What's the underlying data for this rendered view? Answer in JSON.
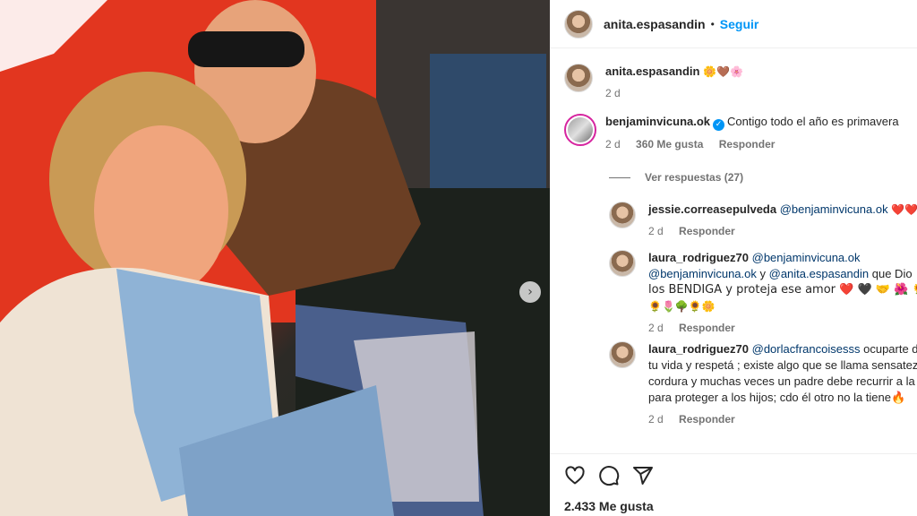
{
  "post": {
    "author": "anita.espasandin",
    "separator": "•",
    "follow_label": "Seguir",
    "likes_total": "2.433 Me gusta"
  },
  "comments": [
    {
      "user": "anita.espasandin",
      "text": "🌼🤎🌸",
      "time": "2 d"
    },
    {
      "user": "benjaminvicuna.ok",
      "text": "Contigo todo el año es primavera",
      "time": "2 d",
      "likes": "360 Me gusta",
      "reply": "Responder",
      "view_replies": "Ver respuestas (27)"
    }
  ],
  "replies": [
    {
      "user": "jessie.correasepulveda",
      "mention": "@benjaminvicuna.ok",
      "text": "❤️❤️",
      "time": "2 d",
      "reply": "Responder"
    },
    {
      "user": "laura_rodriguez70",
      "mention": "@benjaminvicuna.ok",
      "line2_mention1": "@benjaminvicuna.ok",
      "line2_y": "y",
      "line2_mention2": "@anita.espasandin",
      "line2_text": "que Dio",
      "line3": "los BENDIGA y proteja ese amor ❤️ 🖤 🤝 🌺 🌻 🌼",
      "line4": "🌻🌷🌳🌻🌼",
      "time": "2 d",
      "reply": "Responder"
    },
    {
      "user": "laura_rodriguez70",
      "mention": "@dorlacfrancoisesss",
      "text": "ocuparte d",
      "line2": "tu vida y respetá ; existe algo que se llama sensatez",
      "line3": "cordura y muchas veces un padre debe recurrir a la",
      "line4": "para proteger a los hijos; cdo él otro no la tiene🔥",
      "time": "2 d",
      "reply": "Responder"
    }
  ],
  "icons": {
    "like": "heart-icon",
    "comment": "comment-icon",
    "share": "share-icon",
    "verified": "verified-badge-icon",
    "next": "chevron-right-icon"
  },
  "colors": {
    "accent": "#0095f6",
    "mention": "#00376b",
    "muted": "#737373"
  }
}
